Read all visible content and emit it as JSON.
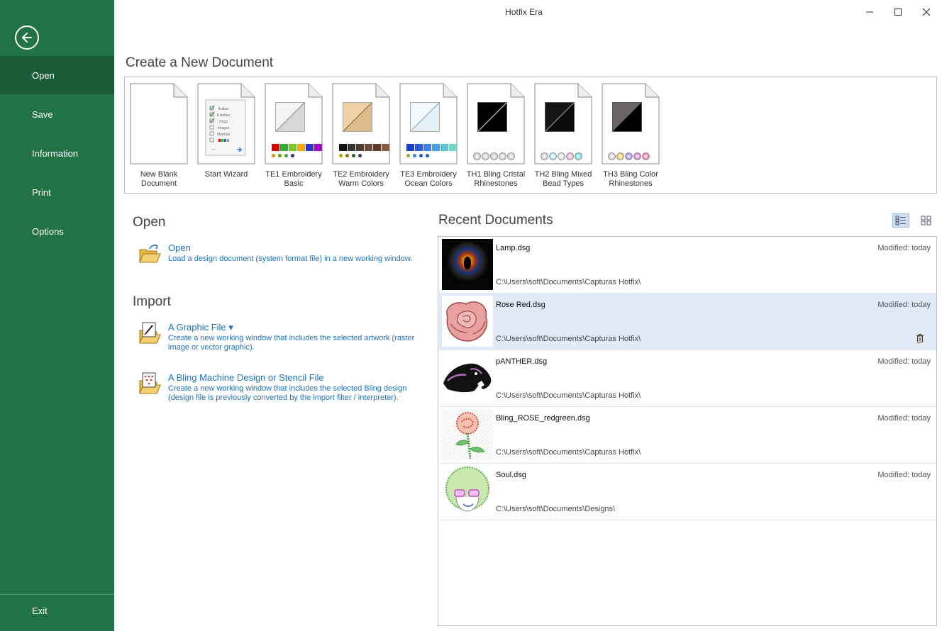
{
  "window": {
    "title": "Hotfix Era"
  },
  "sidebar": {
    "items": [
      {
        "label": "Open"
      },
      {
        "label": "Save"
      },
      {
        "label": "Information"
      },
      {
        "label": "Print"
      },
      {
        "label": "Options"
      }
    ],
    "exit_label": "Exit",
    "color": "#217346"
  },
  "create": {
    "title": "Create a New Document",
    "templates": [
      {
        "label": "New Blank Document"
      },
      {
        "label": "Start Wizard",
        "wizard_items": [
          "Author",
          "Palettes",
          "Hoop",
          "Images",
          "Material"
        ]
      },
      {
        "label": "TE1 Embroidery Basic"
      },
      {
        "label": "TE2 Embroidery Warm Colors"
      },
      {
        "label": "TE3 Embroidery Ocean Colors"
      },
      {
        "label": "TH1 Bling Cristal Rhinestones"
      },
      {
        "label": "TH2 Bling Mixed Bead Types"
      },
      {
        "label": "TH3 Bling Color Rhinestones"
      }
    ]
  },
  "open_section": {
    "title": "Open",
    "open_title": "Open",
    "open_desc": "Load a design document (system format file) in a new working window."
  },
  "import_section": {
    "title": "Import",
    "graphic_title": "A Graphic File ▾",
    "graphic_desc": "Create a new working window that includes the selected artwork (raster image or vector graphic).",
    "bling_title": "A Bling Machine Design or Stencil File",
    "bling_desc": "Create a new working window that includes the selected Bling design (design file is previously converted by the import filter / interpreter)."
  },
  "recent": {
    "title": "Recent Documents",
    "items": [
      {
        "name": "Lamp.dsg",
        "path": "C:\\Users\\soft\\Documents\\Capturas Hotfix\\",
        "modified": "Modified: today"
      },
      {
        "name": "Rose Red.dsg",
        "path": "C:\\Users\\soft\\Documents\\Capturas Hotfix\\",
        "modified": "Modified: today"
      },
      {
        "name": "pANTHER.dsg",
        "path": "C:\\Users\\soft\\Documents\\Capturas Hotfix\\",
        "modified": "Modified: today"
      },
      {
        "name": "Bling_ROSE_redgreen.dsg",
        "path": "C:\\Users\\soft\\Documents\\Capturas Hotfix\\",
        "modified": "Modified: today"
      },
      {
        "name": "Soul.dsg",
        "path": "C:\\Users\\soft\\Documents\\Designs\\",
        "modified": "Modified: today"
      }
    ],
    "selected_index": 1
  },
  "colors": {
    "accent_link": "#1e73be",
    "selected_row": "#dfe9f7"
  }
}
